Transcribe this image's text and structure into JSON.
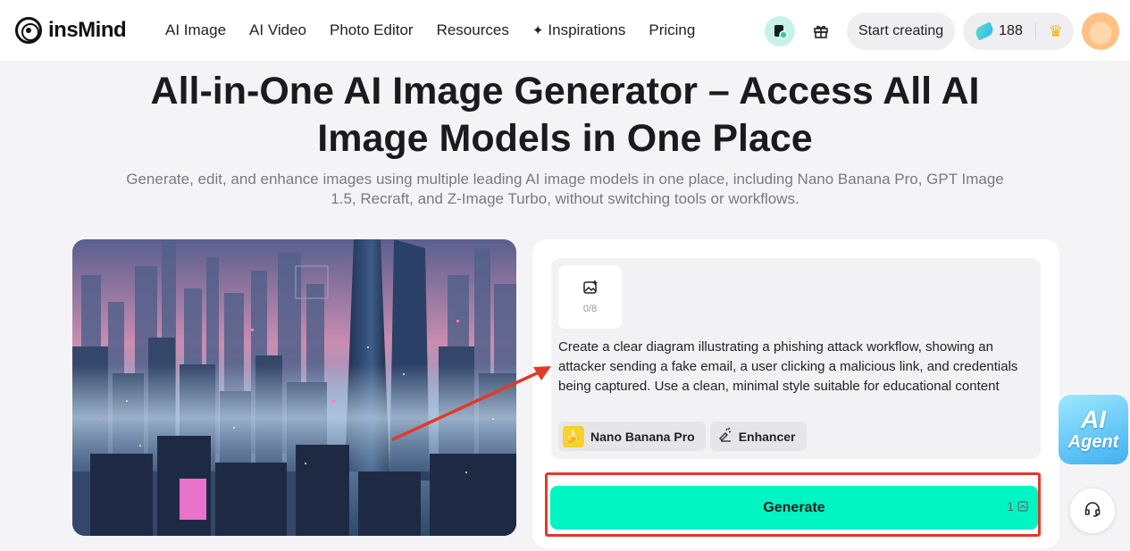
{
  "header": {
    "brand": "insMind",
    "nav": [
      "AI Image",
      "AI Video",
      "Photo Editor",
      "Resources",
      "Inspirations",
      "Pricing"
    ],
    "start_creating": "Start creating",
    "credits": "188"
  },
  "hero": {
    "title_line1": "All-in-One AI Image Generator – Access All AI",
    "title_line2": "Image Models in One Place",
    "subtitle": "Generate, edit, and enhance images using multiple leading AI image models in one place, including Nano Banana Pro, GPT Image 1.5, Recraft, and Z-Image Turbo, without switching tools or workflows."
  },
  "generator": {
    "upload_count": "0/8",
    "prompt": "Create a clear diagram illustrating a phishing attack workflow, showing an attacker sending a fake email, a user clicking a malicious link, and credentials being captured. Use a clean, minimal style suitable for educational content",
    "model_chip": "Nano Banana Pro",
    "enhancer_chip": "Enhancer",
    "generate_label": "Generate",
    "generate_cost": "1"
  },
  "floating": {
    "agent_line1": "AI",
    "agent_line2": "Agent"
  },
  "colors": {
    "accent": "#00f5c3",
    "annotation_red": "#e23a2a"
  },
  "icons": {
    "logo": "insmind-logo-icon",
    "inspirations": "sparkle-icon",
    "gift": "gift-icon",
    "gem": "gem-icon",
    "crown": "crown-icon",
    "upload": "image-upload-icon",
    "enhancer": "enhancer-icon",
    "support": "headset-icon"
  }
}
